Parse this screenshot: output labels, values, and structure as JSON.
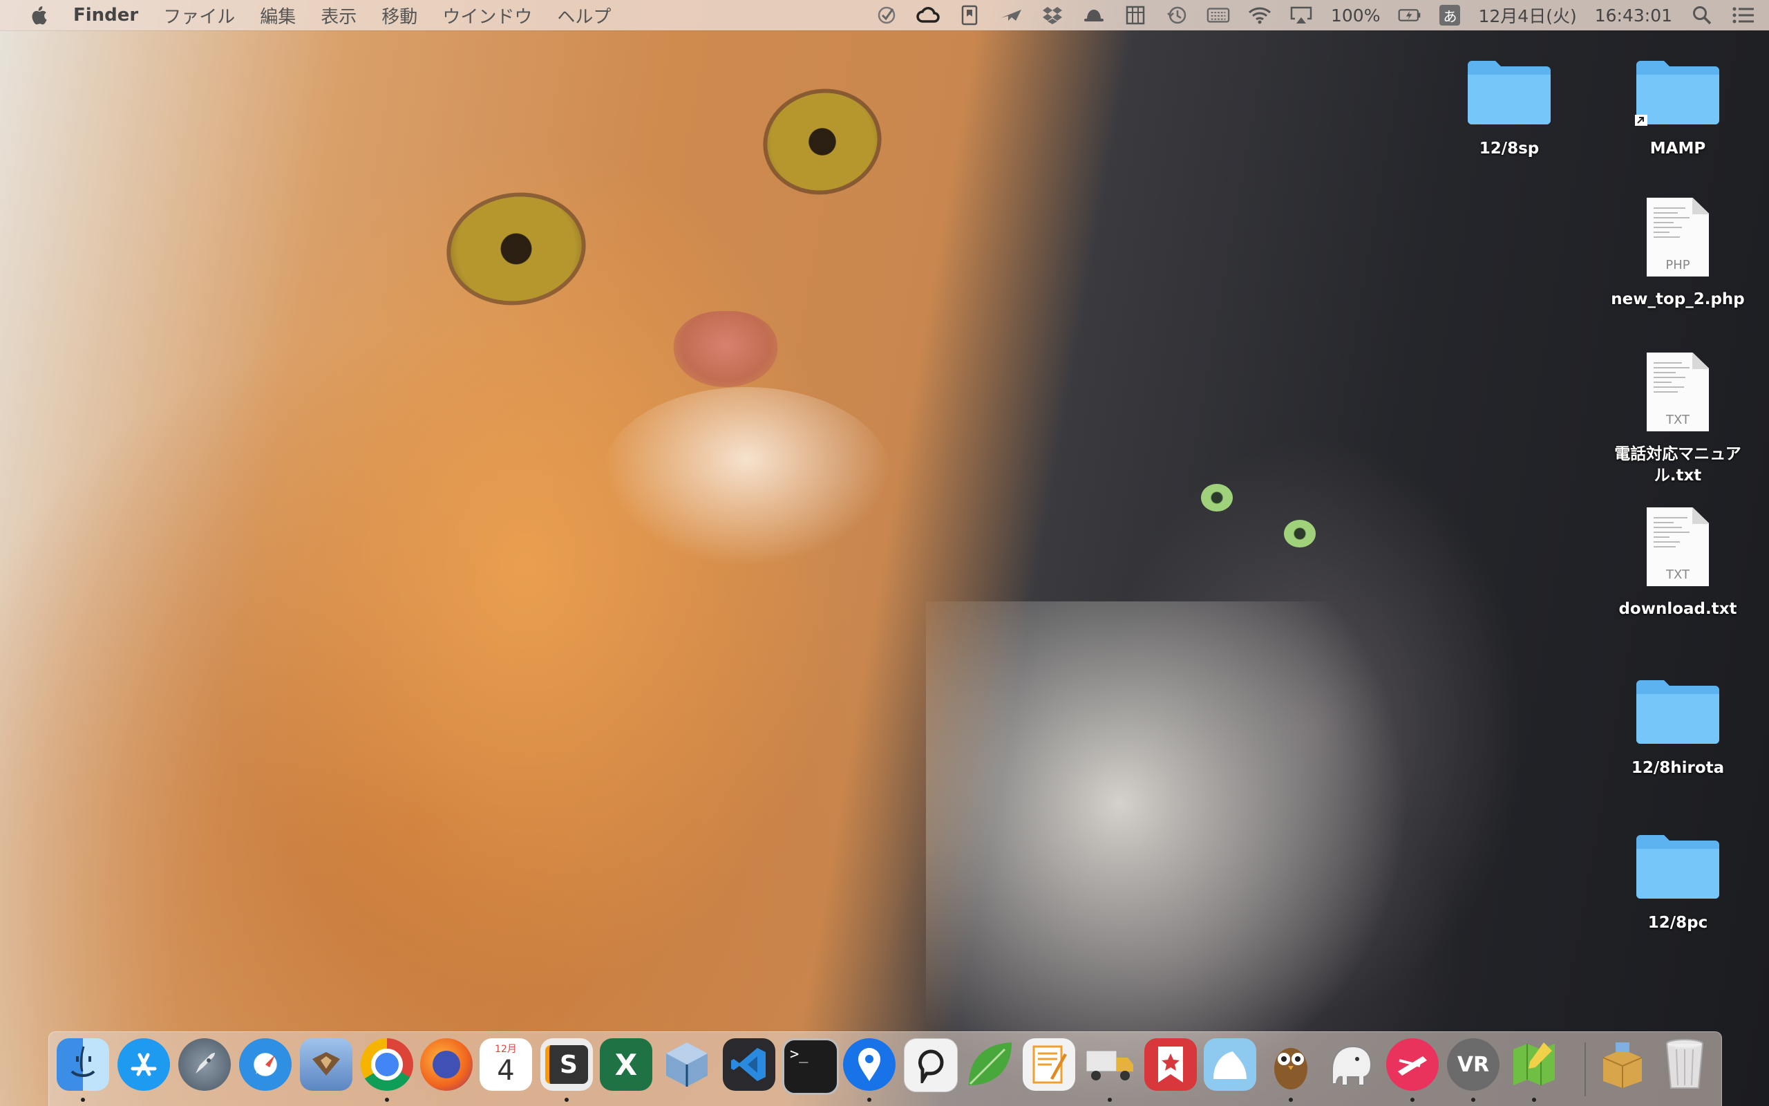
{
  "menubar": {
    "app_name": "Finder",
    "menus": [
      "ファイル",
      "編集",
      "表示",
      "移動",
      "ウインドウ",
      "ヘルプ"
    ],
    "status_icons": [
      "checkmark-icon",
      "creative-cloud-icon",
      "bookmark-icon",
      "airplane-icon",
      "dropbox-icon",
      "hat-icon",
      "grid-icon",
      "time-machine-icon",
      "keyboard-icon",
      "wifi-icon",
      "airplay-icon"
    ],
    "battery": "100%",
    "input_method": "あ",
    "date": "12月4日(火)",
    "time": "16:43:01"
  },
  "desktop": {
    "icons": [
      {
        "type": "folder",
        "label": "12/8sp"
      },
      {
        "type": "folder-alias",
        "label": "MAMP"
      },
      {
        "type": "document",
        "ext": "PHP",
        "label": "new_top_2.php"
      },
      {
        "type": "document",
        "ext": "TXT",
        "label": "電話対応マニュアル.txt"
      },
      {
        "type": "document",
        "ext": "TXT",
        "label": "download.txt"
      },
      {
        "type": "folder",
        "label": "12/8hirota"
      },
      {
        "type": "folder",
        "label": "12/8pc"
      }
    ]
  },
  "dock": {
    "calendar_month": "12月",
    "calendar_day": "4",
    "apps": [
      {
        "name": "finder-app-icon",
        "color": "#3d8ee8"
      },
      {
        "name": "app-store-app-icon",
        "color": "#1e9bf0"
      },
      {
        "name": "launchpad-app-icon",
        "color": "#5b6b7c"
      },
      {
        "name": "safari-app-icon",
        "color": "#2f8fe3"
      },
      {
        "name": "mail-app-icon",
        "color": "#6f9ed6"
      },
      {
        "name": "chrome-app-icon",
        "color": "#e9e9e9"
      },
      {
        "name": "firefox-app-icon",
        "color": "#f0641e"
      },
      {
        "name": "calendar-app-icon",
        "color": "#ffffff"
      },
      {
        "name": "sublime-app-icon",
        "color": "#ececec"
      },
      {
        "name": "excel-app-icon",
        "color": "#1f7244"
      },
      {
        "name": "virtualbox-app-icon",
        "color": "#7fa6cf"
      },
      {
        "name": "vscode-app-icon",
        "color": "#2a6db5"
      },
      {
        "name": "terminal-app-icon",
        "color": "#1c1c1c"
      },
      {
        "name": "maps-pin-app-icon",
        "color": "#1873e8"
      },
      {
        "name": "clip-studio-app-icon",
        "color": "#f2f2f2"
      },
      {
        "name": "leaf-app-icon",
        "color": "#49a83c"
      },
      {
        "name": "pages-app-icon",
        "color": "#f2f2f2"
      },
      {
        "name": "transmit-app-icon",
        "color": "#e7b23c"
      },
      {
        "name": "wunderlist-app-icon",
        "color": "#d8383c"
      },
      {
        "name": "cloud-app-icon",
        "color": "#8ec9f0"
      },
      {
        "name": "owl-app-icon",
        "color": "#8a5b2a"
      },
      {
        "name": "elephant-app-icon",
        "color": "#f0f0f0"
      },
      {
        "name": "skitch-app-icon",
        "color": "#e9325c"
      },
      {
        "name": "vr-app-icon",
        "color": "#6b6b6b"
      },
      {
        "name": "map-app-icon",
        "color": "#6fbf45"
      },
      {
        "name": "archive-utility-icon",
        "color": "#d9a54a"
      },
      {
        "name": "trash-icon",
        "color": "#e6e6e6"
      }
    ],
    "running_indicators": [
      "finder-app-icon",
      "chrome-app-icon",
      "sublime-app-icon",
      "maps-pin-app-icon",
      "transmit-app-icon",
      "owl-app-icon",
      "skitch-app-icon",
      "vr-app-icon",
      "map-app-icon"
    ]
  }
}
